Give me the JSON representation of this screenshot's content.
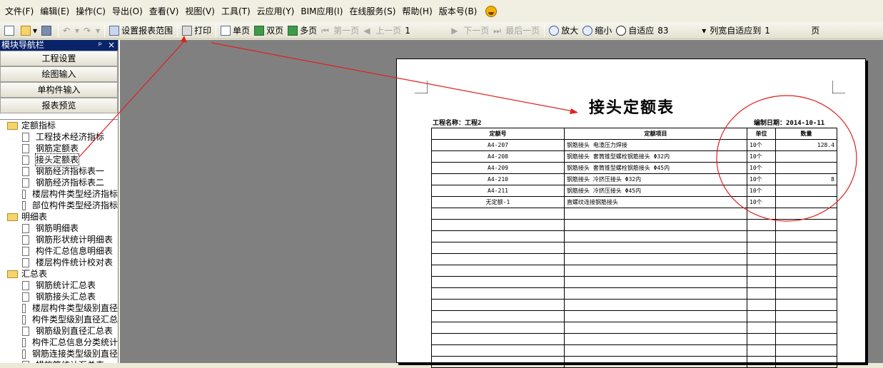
{
  "menu": [
    "文件(F)",
    "编辑(E)",
    "操作(C)",
    "导出(O)",
    "查看(V)",
    "视图(V)",
    "工具(T)",
    "云应用(Y)",
    "BIM应用(I)",
    "在线服务(S)",
    "帮助(H)",
    "版本号(B)"
  ],
  "toolbar": {
    "set_range": "设置报表范围",
    "print": "打印",
    "single_page": "单页",
    "double_page": "双页",
    "multi_page": "多页",
    "first_page": "第一页",
    "prev_page": "上一页",
    "page_number": "1",
    "next_page": "下一页",
    "last_page": "最后一页",
    "zoom_in": "放大",
    "zoom_out": "缩小",
    "fit": "自适应",
    "zoom_value": "83",
    "col_fit": "列宽自适应到",
    "col_fit_value": "1",
    "page_unit": "页"
  },
  "sidebar": {
    "title": "模块导航栏",
    "pin": "ᵖ",
    "close": "×",
    "modules": [
      "工程设置",
      "绘图输入",
      "单构件输入",
      "报表预览"
    ],
    "tree": [
      {
        "type": "folder",
        "label": "定额指标"
      },
      {
        "type": "doc",
        "label": "工程技术经济指标"
      },
      {
        "type": "doc",
        "label": "钢筋定额表"
      },
      {
        "type": "doc",
        "label": "接头定额表",
        "selected": true
      },
      {
        "type": "doc",
        "label": "钢筋经济指标表一"
      },
      {
        "type": "doc",
        "label": "钢筋经济指标表二"
      },
      {
        "type": "doc",
        "label": "楼层构件类型经济指标"
      },
      {
        "type": "doc",
        "label": "部位构件类型经济指标"
      },
      {
        "type": "folder",
        "label": "明细表"
      },
      {
        "type": "doc",
        "label": "钢筋明细表"
      },
      {
        "type": "doc",
        "label": "钢筋形状统计明细表"
      },
      {
        "type": "doc",
        "label": "构件汇总信息明细表"
      },
      {
        "type": "doc",
        "label": "楼层构件统计校对表"
      },
      {
        "type": "folder",
        "label": "汇总表"
      },
      {
        "type": "doc",
        "label": "钢筋统计汇总表"
      },
      {
        "type": "doc",
        "label": "钢筋接头汇总表"
      },
      {
        "type": "doc",
        "label": "楼层构件类型级别直径"
      },
      {
        "type": "doc",
        "label": "构件类型级别直径汇总"
      },
      {
        "type": "doc",
        "label": "钢筋级别直径汇总表"
      },
      {
        "type": "doc",
        "label": "构件汇总信息分类统计"
      },
      {
        "type": "doc",
        "label": "钢筋连接类型级别直径"
      },
      {
        "type": "doc",
        "label": "措施筋统计汇总表"
      }
    ]
  },
  "report": {
    "title": "接头定额表",
    "project_label": "工程名称：工程2",
    "date_label": "编制日期：2014-10-11",
    "columns": [
      "定额号",
      "定额项目",
      "单位",
      "数量"
    ],
    "rows": [
      [
        "A4-207",
        "钢筋接头 电渣压力焊接",
        "10个",
        "128.4"
      ],
      [
        "A4-208",
        "钢筋接头 套筒锥型螺栓钢筋接头 Φ32内",
        "10个",
        ""
      ],
      [
        "A4-209",
        "钢筋接头 套筒锥型螺栓钢筋接头 Φ45内",
        "10个",
        ""
      ],
      [
        "A4-210",
        "钢筋接头 冷挤压接头 Φ32内",
        "10个",
        "8"
      ],
      [
        "A4-211",
        "钢筋接头 冷挤压接头 Φ45内",
        "10个",
        ""
      ],
      [
        "无定额-1",
        "直螺纹连接钢筋接头",
        "10个",
        ""
      ]
    ],
    "blank_rows": 14
  },
  "colors": {
    "annotation": "#e02020",
    "title_bar": "#0a246a",
    "canvas_bg": "#808080"
  }
}
